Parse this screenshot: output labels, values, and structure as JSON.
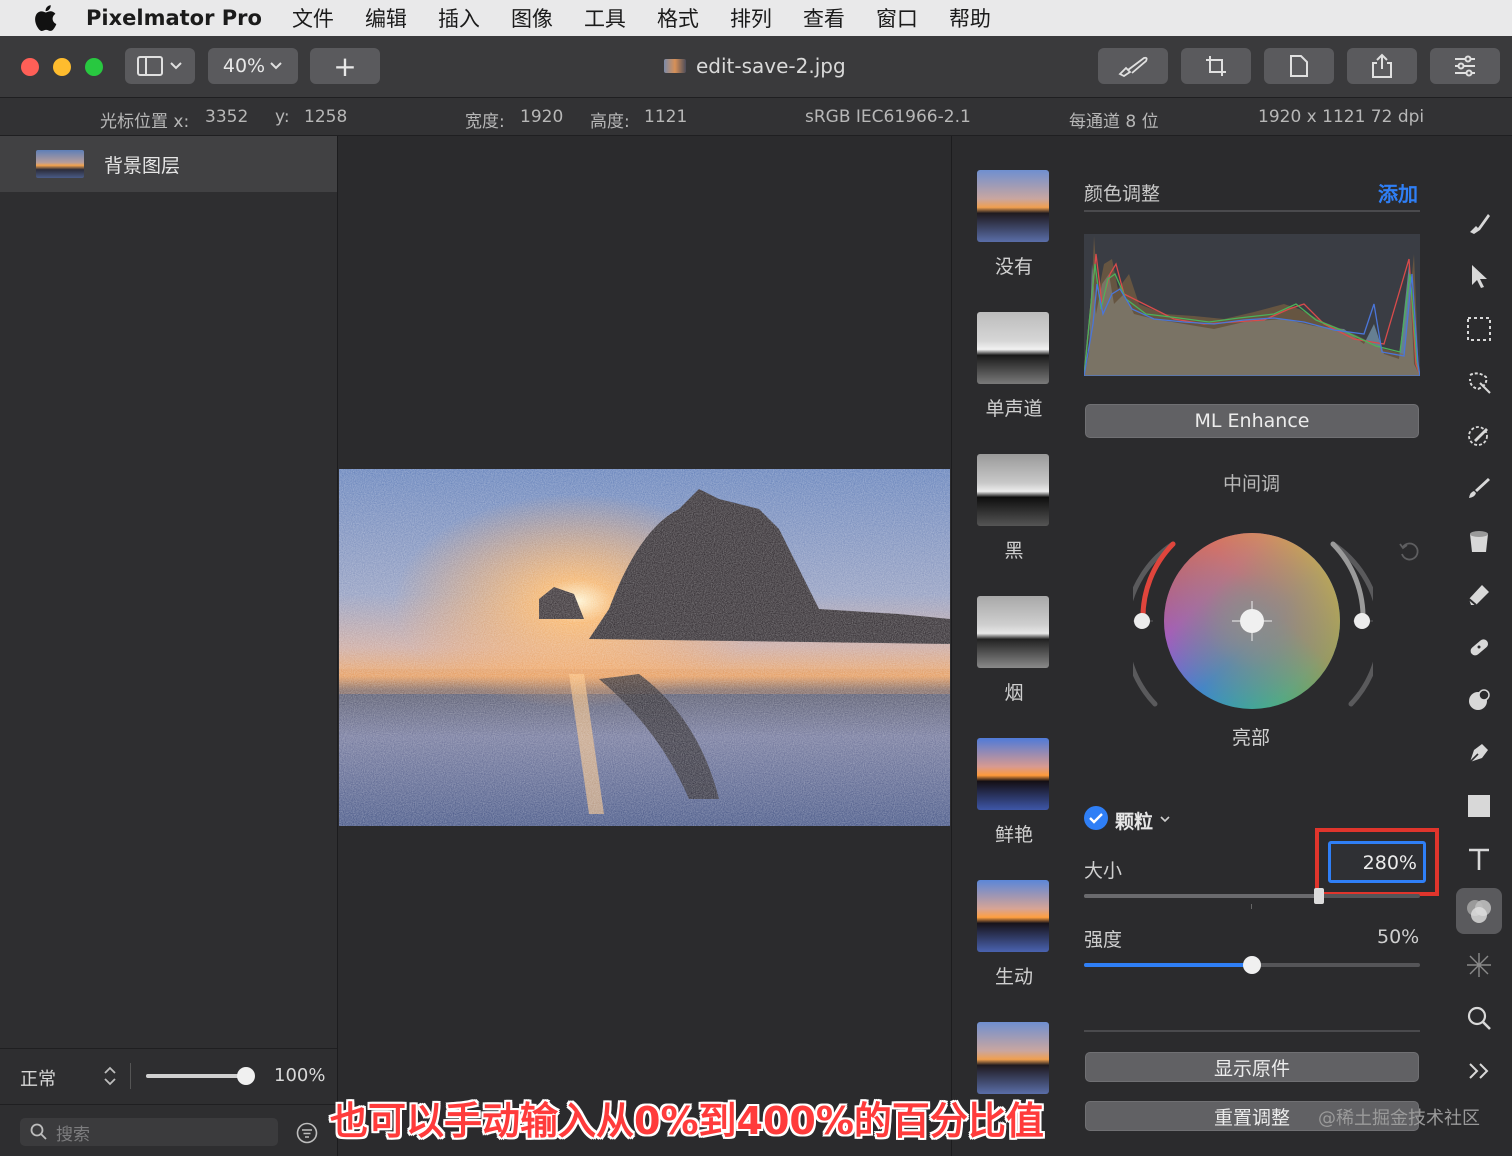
{
  "menubar": {
    "app_name": "Pixelmator Pro",
    "items": [
      "文件",
      "编辑",
      "插入",
      "图像",
      "工具",
      "格式",
      "排列",
      "查看",
      "窗口",
      "帮助"
    ]
  },
  "toolbar": {
    "zoom": "40%",
    "add_symbol": "+",
    "document_title": "edit-save-2.jpg"
  },
  "infobar": {
    "cursor_x_label": "光标位置 x:",
    "cursor_x": "3352",
    "cursor_y_label": "y:",
    "cursor_y": "1258",
    "width_label": "宽度:",
    "width": "1920",
    "height_label": "高度:",
    "height": "1121",
    "color_profile": "sRGB IEC61966-2.1",
    "bit_depth": "每通道 8 位",
    "resolution": "1920 x 1121 72 dpi"
  },
  "layers": {
    "items": [
      {
        "name": "背景图层"
      }
    ],
    "blend_mode": "正常",
    "opacity": "100%",
    "opacity_value": 1.0,
    "search_placeholder": "搜索"
  },
  "presets": [
    {
      "label": "没有"
    },
    {
      "label": "单声道"
    },
    {
      "label": "黑"
    },
    {
      "label": "烟"
    },
    {
      "label": "鲜艳"
    },
    {
      "label": "生动"
    },
    {
      "label": ""
    }
  ],
  "adjustments": {
    "section_title": "颜色调整",
    "add_label": "添加",
    "ml_enhance": "ML Enhance",
    "midtones_label": "中间调",
    "highlights_label": "亮部",
    "grain": {
      "label": "颗粒",
      "enabled": true,
      "size_label": "大小",
      "size_value": "280%",
      "size_fraction": 0.7,
      "strength_label": "强度",
      "strength_value": "50%",
      "strength_fraction": 0.5
    },
    "show_original": "显示原件",
    "reset": "重置调整"
  },
  "tools": [
    "style-brush-icon",
    "arrange-pointer-icon",
    "rect-select-icon",
    "magic-select-icon",
    "color-picker-icon",
    "paint-brush-icon",
    "fill-bucket-icon",
    "eraser-icon",
    "repair-icon",
    "retouch-icon",
    "pen-icon",
    "shape-icon",
    "type-icon",
    "color-adjust-icon",
    "effects-icon",
    "zoom-icon",
    "more-tools-icon"
  ],
  "colors": {
    "accent": "#2f7ff6",
    "highlight_box": "#e0352c",
    "close": "#fe5f57",
    "minimize": "#febc2e",
    "zoom": "#28c840"
  },
  "caption": "也可以手动输入从0%到400%的百分比值",
  "watermark": "@稀土掘金技术社区"
}
